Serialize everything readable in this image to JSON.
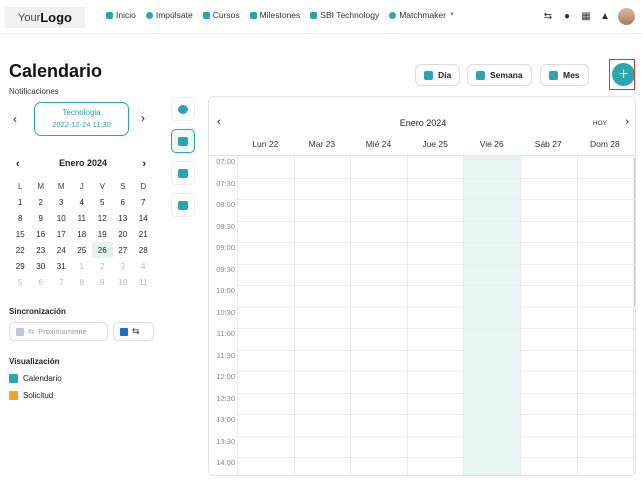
{
  "header": {
    "logo_light": "Your",
    "logo_bold": "Logo",
    "nav": [
      {
        "label": "Inicio",
        "icon": "home-icon"
      },
      {
        "label": "Impúlsate",
        "icon": "rocket-icon"
      },
      {
        "label": "Cursos",
        "icon": "chart-icon"
      },
      {
        "label": "Milestones",
        "icon": "layers-icon"
      },
      {
        "label": "SBI Technology",
        "icon": "building-icon"
      },
      {
        "label": "Matchmaker",
        "icon": "search-icon"
      }
    ]
  },
  "page": {
    "title": "Calendario",
    "notifications_label": "Notificaciones",
    "notification": {
      "category": "Tecnologia",
      "datetime": "2022-12-24 11:30"
    }
  },
  "mini_calendar": {
    "month": "Enero 2024",
    "weekdays": [
      "L",
      "M",
      "M",
      "J",
      "V",
      "S",
      "D"
    ],
    "days": [
      {
        "d": "1"
      },
      {
        "d": "2"
      },
      {
        "d": "3"
      },
      {
        "d": "4"
      },
      {
        "d": "5"
      },
      {
        "d": "6"
      },
      {
        "d": "7"
      },
      {
        "d": "8"
      },
      {
        "d": "9"
      },
      {
        "d": "10"
      },
      {
        "d": "11"
      },
      {
        "d": "12"
      },
      {
        "d": "13"
      },
      {
        "d": "14"
      },
      {
        "d": "15"
      },
      {
        "d": "16"
      },
      {
        "d": "17"
      },
      {
        "d": "18"
      },
      {
        "d": "19"
      },
      {
        "d": "20"
      },
      {
        "d": "21"
      },
      {
        "d": "22"
      },
      {
        "d": "23"
      },
      {
        "d": "24"
      },
      {
        "d": "25"
      },
      {
        "d": "26",
        "today": true
      },
      {
        "d": "27"
      },
      {
        "d": "28"
      },
      {
        "d": "29"
      },
      {
        "d": "30"
      },
      {
        "d": "31"
      },
      {
        "d": "1",
        "muted": true
      },
      {
        "d": "2",
        "muted": true
      },
      {
        "d": "3",
        "muted": true
      },
      {
        "d": "4",
        "muted": true
      },
      {
        "d": "5",
        "muted": true
      },
      {
        "d": "6",
        "muted": true
      },
      {
        "d": "7",
        "muted": true
      },
      {
        "d": "8",
        "muted": true
      },
      {
        "d": "9",
        "muted": true
      },
      {
        "d": "10",
        "muted": true
      },
      {
        "d": "11",
        "muted": true
      }
    ]
  },
  "sync": {
    "label": "Sincronización",
    "google_label": "Proximamente"
  },
  "visualization": {
    "label": "Visualización",
    "items": [
      {
        "label": "Calendario",
        "color": "#2aa6b0"
      },
      {
        "label": "Solicitud",
        "color": "#f5a623"
      }
    ]
  },
  "views": {
    "day": "Día",
    "week": "Semana",
    "month": "Mes",
    "add": "+"
  },
  "calendar": {
    "month": "Enero 2024",
    "today_label": "HOY",
    "days": [
      "Lun 22",
      "Mar 23",
      "Mié 24",
      "Jue 25",
      "Vie 26",
      "Sáb 27",
      "Dom 28"
    ],
    "highlight_day_index": 4,
    "times": [
      "07:00",
      "07:30",
      "08:00",
      "08:30",
      "09:00",
      "09:30",
      "10:00",
      "10:30",
      "11:00",
      "11:30",
      "12:00",
      "12:30",
      "13:00",
      "13:30",
      "14:00"
    ]
  },
  "colors": {
    "accent": "#2aa6b0",
    "warning": "#f5a623"
  }
}
